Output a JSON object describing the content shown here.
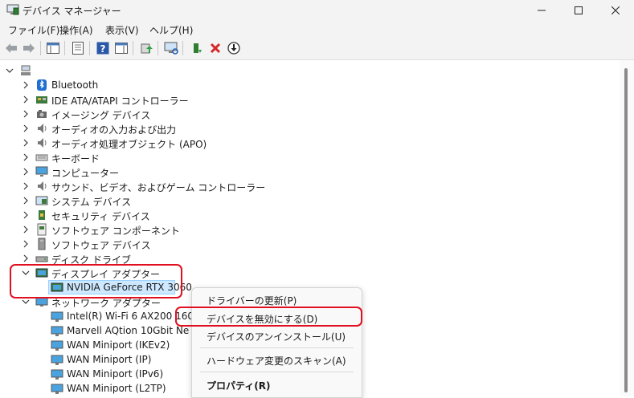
{
  "window": {
    "title": "デバイス マネージャー"
  },
  "menu": [
    "ファイル(F)",
    "操作(A)",
    "表示(V)",
    "ヘルプ(H)"
  ],
  "toolbar": [
    {
      "icon": "back-arrow-icon"
    },
    {
      "icon": "forward-arrow-icon"
    },
    {
      "icon": "show-hide-console-tree-icon"
    },
    {
      "icon": "properties-icon"
    },
    {
      "icon": "help-icon"
    },
    {
      "icon": "action-pane-icon"
    },
    {
      "icon": "update-driver-icon"
    },
    {
      "icon": "scan-hardware-icon"
    },
    {
      "icon": "enable-device-icon"
    },
    {
      "icon": "uninstall-device-icon"
    },
    {
      "icon": "download-driver-icon"
    }
  ],
  "tree": {
    "items": [
      {
        "label": "Bluetooth",
        "icon": "bluetooth-icon"
      },
      {
        "label": "IDE ATA/ATAPI コントローラー",
        "icon": "ide-controller-icon"
      },
      {
        "label": "イメージング デバイス",
        "icon": "camera-icon"
      },
      {
        "label": "オーディオの入力および出力",
        "icon": "speaker-icon"
      },
      {
        "label": "オーディオ処理オブジェクト (APO)",
        "icon": "speaker-icon"
      },
      {
        "label": "キーボード",
        "icon": "keyboard-icon"
      },
      {
        "label": "コンピューター",
        "icon": "monitor-icon"
      },
      {
        "label": "サウンド、ビデオ、およびゲーム コントローラー",
        "icon": "speaker-icon"
      },
      {
        "label": "システム デバイス",
        "icon": "system-device-icon"
      },
      {
        "label": "セキュリティ デバイス",
        "icon": "security-device-icon"
      },
      {
        "label": "ソフトウェア コンポーネント",
        "icon": "software-component-icon"
      },
      {
        "label": "ソフトウェア デバイス",
        "icon": "software-device-icon"
      },
      {
        "label": "ディスク ドライブ",
        "icon": "disk-drive-icon"
      },
      {
        "label": "ディスプレイ アダプター",
        "icon": "display-adapter-icon"
      },
      {
        "label": "NVIDIA GeForce RTX 3060",
        "icon": "display-adapter-icon"
      },
      {
        "label": "ネットワーク アダプター",
        "icon": "network-adapter-icon"
      },
      {
        "label": "Intel(R) Wi-Fi 6 AX200 160",
        "icon": "network-card-icon"
      },
      {
        "label": "Marvell AQtion 10Gbit Ne",
        "icon": "network-card-icon"
      },
      {
        "label": "WAN Miniport (IKEv2)",
        "icon": "network-card-icon"
      },
      {
        "label": "WAN Miniport (IP)",
        "icon": "network-card-icon"
      },
      {
        "label": "WAN Miniport (IPv6)",
        "icon": "network-card-icon"
      },
      {
        "label": "WAN Miniport (L2TP)",
        "icon": "network-card-icon"
      }
    ]
  },
  "context_menu": {
    "update_driver": "ドライバーの更新(P)",
    "disable_device": "デバイスを無効にする(D)",
    "uninstall_device": "デバイスのアンインストール(U)",
    "scan_hardware": "ハードウェア変更のスキャン(A)",
    "properties": "プロパティ(R)"
  },
  "colors": {
    "highlight": "#e01020",
    "selection": "#cde8ff",
    "accent": "#0067c0"
  }
}
